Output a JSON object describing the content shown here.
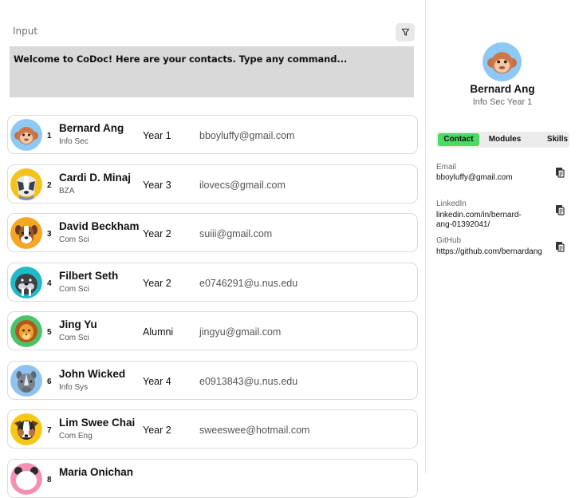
{
  "input": {
    "label": "Input"
  },
  "output": {
    "text": "Welcome to  CoDoc! Here are your contacts. Type any command..."
  },
  "contacts": [
    {
      "index": "1",
      "name": "Bernard Ang",
      "dept": "Info Sec",
      "year": "Year 1",
      "email": "bboyluffy@gmail.com",
      "avatar": "monkey-avatar"
    },
    {
      "index": "2",
      "name": "Cardi D. Minaj",
      "dept": "BZA",
      "year": "Year 3",
      "email": "ilovecs@gmail.com",
      "avatar": "badger-avatar"
    },
    {
      "index": "3",
      "name": "David Beckham",
      "dept": "Com Sci",
      "year": "Year 2",
      "email": "suiii@gmail.com",
      "avatar": "dog-avatar"
    },
    {
      "index": "4",
      "name": "Filbert Seth",
      "dept": "Com Sci",
      "year": "Year 2",
      "email": "e0746291@u.nus.edu",
      "avatar": "walrus-avatar"
    },
    {
      "index": "5",
      "name": "Jing Yu",
      "dept": "Com Sci",
      "year": "Alumni",
      "email": "jingyu@gmail.com",
      "avatar": "lion-avatar"
    },
    {
      "index": "6",
      "name": "John Wicked",
      "dept": "Info Sys",
      "year": "Year 4",
      "email": "e0913843@u.nus.edu",
      "avatar": "rhino-avatar"
    },
    {
      "index": "7",
      "name": "Lim Swee Chai",
      "dept": "Com Eng",
      "year": "Year 2",
      "email": "sweeswee@hotmail.com",
      "avatar": "collie-avatar"
    },
    {
      "index": "8",
      "name": "Maria Onichan",
      "dept": "",
      "year": "",
      "email": "",
      "avatar": "panda-avatar"
    }
  ],
  "profile": {
    "name": "Bernard Ang",
    "subtitle": "Info Sec Year 1",
    "tabs": [
      "Contact",
      "Modules",
      "Skills"
    ],
    "active_tab": "Contact",
    "fields": [
      {
        "label": "Email",
        "value": "bboyluffy@gmail.com"
      },
      {
        "label": "LinkedIn",
        "value": "linkedin.com/in/bernard-ang-01392041/"
      },
      {
        "label": "GitHub",
        "value": "https://github.com/bernardang"
      }
    ]
  },
  "colors": {
    "accent": "#4cd964",
    "output_bg": "#d9d9d9",
    "card_border": "#dcdcdc"
  }
}
